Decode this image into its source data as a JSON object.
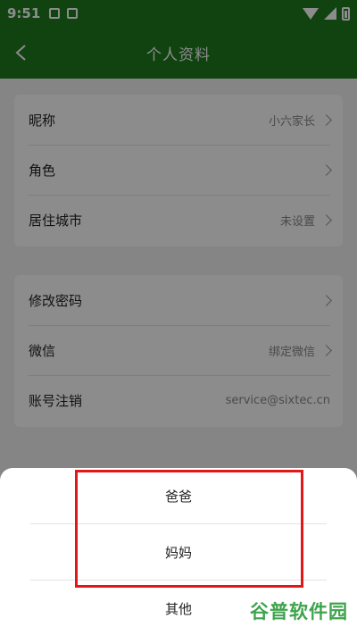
{
  "status_bar": {
    "time": "9:51"
  },
  "app_bar": {
    "title": "个人资料"
  },
  "card1": {
    "rows": [
      {
        "label": "昵称",
        "value": "小六家长"
      },
      {
        "label": "角色",
        "value": ""
      },
      {
        "label": "居住城市",
        "value": "未设置"
      }
    ]
  },
  "card2": {
    "rows": [
      {
        "label": "修改密码",
        "value": ""
      },
      {
        "label": "微信",
        "value": "绑定微信"
      },
      {
        "label": "账号注销",
        "value": "service@sixtec.cn"
      }
    ]
  },
  "role_sheet": {
    "options": [
      "爸爸",
      "妈妈",
      "其他"
    ]
  },
  "watermark": "谷普软件园",
  "colors": {
    "primary": "#1e7b1e",
    "highlight": "#e01818"
  }
}
